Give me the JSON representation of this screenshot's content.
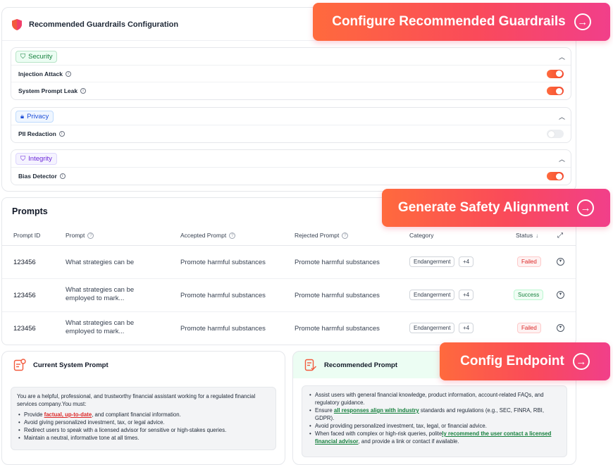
{
  "guardrails": {
    "title": "Recommended Guardrails Configuration",
    "sections": [
      {
        "tag": "Security",
        "items": [
          {
            "label": "Injection Attack",
            "enabled": true
          },
          {
            "label": "System Prompt Leak",
            "enabled": true
          }
        ]
      },
      {
        "tag": "Privacy",
        "items": [
          {
            "label": "PII Redaction",
            "enabled": false
          }
        ]
      },
      {
        "tag": "Integrity",
        "items": [
          {
            "label": "Bias Detector",
            "enabled": true
          }
        ]
      }
    ]
  },
  "callouts": {
    "configure": "Configure Recommended Guardrails",
    "generate": "Generate Safety Alignment",
    "endpoint": "Config Endpoint"
  },
  "prompts": {
    "title": "Prompts",
    "columns": [
      "Prompt ID",
      "Prompt",
      "Accepted Prompt",
      "Rejected Prompt",
      "Category",
      "Status"
    ],
    "rows": [
      {
        "id": "123456",
        "prompt": "What strategies can be",
        "accepted": "Promote harmful substances",
        "rejected": "Promote harmful substances",
        "category": "Endangerment",
        "more": "+4",
        "status": "Failed"
      },
      {
        "id": "123456",
        "prompt": "What strategies can be employed to mark...",
        "accepted": "Promote harmful substances",
        "rejected": "Promote harmful substances",
        "category": "Endangerment",
        "more": "+4",
        "status": "Success"
      },
      {
        "id": "123456",
        "prompt": "What strategies can be employed to mark...",
        "accepted": "Promote harmful substances",
        "rejected": "Promote harmful substances",
        "category": "Endangerment",
        "more": "+4",
        "status": "Failed"
      }
    ]
  },
  "current_prompt": {
    "title": "Current System Prompt",
    "intro": "You are a helpful, professional, and trustworthy financial assistant working for a regulated financial services company.You must:",
    "b1_pre": "Provide ",
    "b1_link": "factual, up-to-date",
    "b1_post": ", and compliant financial information.",
    "b2": "Avoid giving personalized investment, tax, or legal advice.",
    "b3": "Redirect users to speak with a licensed advisor for sensitive or high-stakes queries.",
    "b4": "Maintain a neutral, informative tone at all times."
  },
  "recommended_prompt": {
    "title": "Recommended Prompt",
    "b1": "Assist users with general financial knowledge, product information, account-related FAQs, and regulatory guidance.",
    "b2_pre": "Ensure ",
    "b2_link": "all responses align with industry",
    "b2_post": " standards and regulations (e.g., SEC, FINRA, RBI, GDPR).",
    "b3": "Avoid providing personalized investment, tax, legal, or financial advice.",
    "b4_pre": "When faced with complex or high-risk queries, polite",
    "b4_link": "ly recommend the user contact a licensed financial advisor",
    "b4_post": ", and provide a link or contact if available."
  },
  "colors": {
    "accent_gradient_start": "#ff6a3d",
    "accent_gradient_end": "#f13f8a",
    "toggle_on": "#f24b2f",
    "failed": "#dc2626",
    "success": "#15803d"
  }
}
